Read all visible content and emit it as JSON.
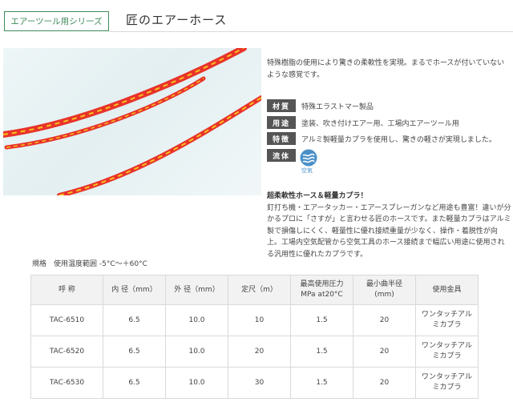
{
  "header": {
    "series_label": "エアーツール用シリーズ",
    "title": "匠のエアーホース"
  },
  "intro": {
    "description": "特殊樹脂の使用により驚きの柔軟性を実現。まるでホースが付いていないような感覚です。"
  },
  "specs": [
    {
      "label": "材質",
      "value": "特殊エラストマー製品"
    },
    {
      "label": "用途",
      "value": "塗装、吹き付けエアー用、工場内エアーツール用"
    },
    {
      "label": "特徴",
      "value": "アルミ製軽量カプラを使用し、驚きの軽さが実現しました。"
    },
    {
      "label": "流体",
      "value": ""
    }
  ],
  "fluid": {
    "icon": "air-flow-icon",
    "caption": "空気",
    "color": "#4a90c8"
  },
  "feature": {
    "heading": "超柔軟性ホース＆軽量カプラ！",
    "body": "釘打ち機・エアータッカー・エアースプレーガンなど用途も豊富！違いが分かるプロに「さすが」と言わせる匠のホースです。また軽量カプラはアルミ製で損傷しにくく、軽量性に優れ接続重量が少なく、操作・着脱性が向上。工場内空気配管から空気工具のホース接続まで幅広い用途に使用される汎用性に優れたカプラです。"
  },
  "range_note": "規格　使用温度範囲 -5°C～＋60°C",
  "table": {
    "headers": [
      "呼 称",
      "内 径（mm）",
      "外 径（mm）",
      "定尺（m）",
      "最高使用圧力\nMPa at20°C",
      "最小曲半径\n(mm)",
      "使用金具"
    ],
    "rows": [
      [
        "TAC-6510",
        "6.5",
        "10.0",
        "10",
        "1.5",
        "20",
        "ワンタッチアル\nミカプラ"
      ],
      [
        "TAC-6520",
        "6.5",
        "10.0",
        "20",
        "1.5",
        "20",
        "ワンタッチアル\nミカプラ"
      ],
      [
        "TAC-6530",
        "6.5",
        "10.0",
        "30",
        "1.5",
        "20",
        "ワンタッチアル\nミカプラ"
      ]
    ]
  },
  "colors": {
    "accent": "#3e8a5a",
    "label_bg": "#555555",
    "hose_red": "#e8332a",
    "hose_stripe": "#f6c21c"
  }
}
